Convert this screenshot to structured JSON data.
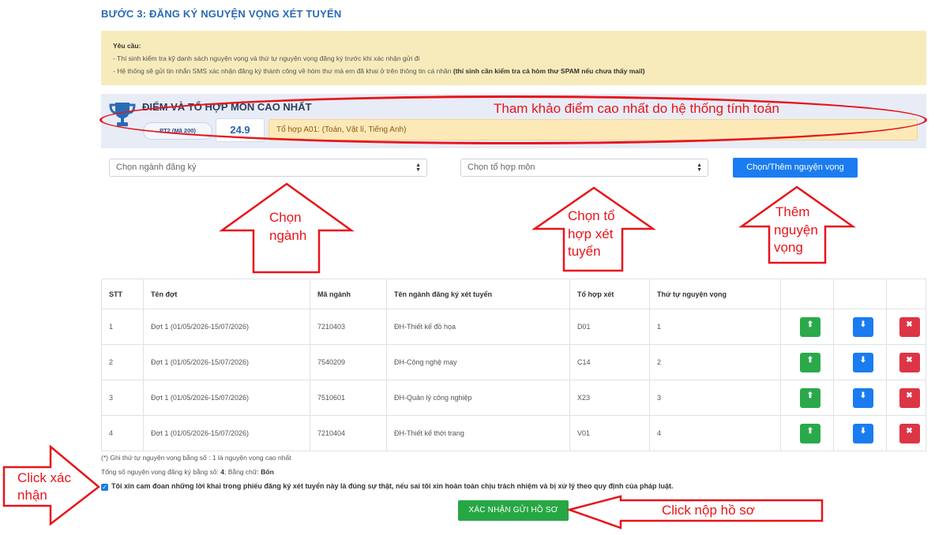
{
  "step_title": "BƯỚC 3: ĐĂNG KÝ NGUYỆN VỌNG XÉT TUYỂN",
  "notice": {
    "heading": "Yêu cầu:",
    "line1": "- Thí sinh kiểm tra kỹ danh sách nguyện vọng và thứ tự nguyện vọng đăng ký trước khi xác nhận gửi đi",
    "line2": "- Hệ thống sẽ gửi tin nhắn SMS xác nhận đăng ký thành công về hòm thư mà em đã khai ở trên thông tin cá nhân ",
    "line2_bold": "(thí sinh cần kiểm tra cả hòm thư SPAM nếu chưa thấy mail)"
  },
  "score_panel": {
    "title": "ĐIỂM VÀ TỔ HỢP MÔN CAO NHẤT",
    "method": "PT2 (Mã 200)",
    "score": "24.9",
    "combination": "Tổ hợp A01: (Toán, Vật lí, Tiếng Anh)"
  },
  "selects": {
    "major": "Chọn ngành đăng ký",
    "combo": "Chọn tổ hợp môn"
  },
  "add_button": "Chọn/Thêm nguyện vọng",
  "table": {
    "headers": [
      "STT",
      "Tên đợt",
      "Mã ngành",
      "Tên ngành đăng ký xét tuyển",
      "Tổ hợp xét",
      "Thứ tự nguyện vọng",
      "",
      "",
      ""
    ],
    "rows": [
      [
        "1",
        "Đợt 1 (01/05/2026-15/07/2026)",
        "7210403",
        "ĐH-Thiết kế đồ họa",
        "D01",
        "1"
      ],
      [
        "2",
        "Đợt 1 (01/05/2026-15/07/2026)",
        "7540209",
        "ĐH-Công nghệ may",
        "C14",
        "2"
      ],
      [
        "3",
        "Đợt 1 (01/05/2026-15/07/2026)",
        "7510601",
        "ĐH-Quản lý công nghiệp",
        "X23",
        "3"
      ],
      [
        "4",
        "Đợt 1 (01/05/2026-15/07/2026)",
        "7210404",
        "ĐH-Thiết kế thời trang",
        "V01",
        "4"
      ]
    ]
  },
  "footer": {
    "note": "(*) Ghi thứ tự nguyện vọng bằng số : 1 là nguyện vọng cao nhất",
    "total_prefix": "Tổng số nguyện vọng đăng ký bằng số: ",
    "total_number": "4",
    "total_mid": "; Bằng chữ: ",
    "total_words": "Bốn",
    "commitment": "Tôi xin cam đoan những lời khai trong phiếu đăng ký xét tuyển này là đúng sự thật, nếu sai tôi xin hoàn toàn chịu trách nhiệm và bị xử lý theo quy định của pháp luật.",
    "submit": "XÁC NHẬN GỬI HỒ SƠ"
  },
  "annotations": {
    "reference": "Tham khảo điểm cao nhất do hệ thống tính toán",
    "choose_major_1": "Chọn",
    "choose_major_2": "ngành",
    "choose_combo_1": "Chọn tổ",
    "choose_combo_2": "hợp xét",
    "choose_combo_3": "tuyển",
    "add_1": "Thêm",
    "add_2": "nguyện",
    "add_3": "vọng",
    "confirm_1": "Click xác",
    "confirm_2": "nhận",
    "submit_hint": "Click nộp hồ sơ"
  },
  "colors": {
    "annotation_red": "#e8141b",
    "primary_blue": "#1a7cf0",
    "success_green": "#27a744",
    "danger_red": "#dc3545"
  }
}
